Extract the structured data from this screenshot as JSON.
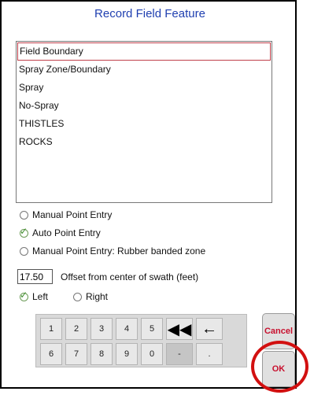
{
  "dialog": {
    "title": "Record Field Feature",
    "features": [
      "Field Boundary",
      "Spray Zone/Boundary",
      "Spray",
      "No-Spray",
      "THISTLES",
      "ROCKS"
    ],
    "selected_feature": "Field Boundary",
    "entry_modes": [
      {
        "label": "Manual Point Entry",
        "checked": false
      },
      {
        "label": "Auto Point Entry",
        "checked": true
      },
      {
        "label": "Manual Point Entry: Rubber banded zone",
        "checked": false
      }
    ],
    "offset": {
      "value": "17.50",
      "label": "Offset from center of swath (feet)"
    },
    "side": {
      "left_label": "Left",
      "right_label": "Right",
      "selected": "Left"
    },
    "keypad": {
      "row1": [
        "1",
        "2",
        "3",
        "4",
        "5",
        "◀◀",
        "←"
      ],
      "row2": [
        "6",
        "7",
        "8",
        "9",
        "0",
        "-",
        "."
      ]
    },
    "cancel_label": "Cancel",
    "ok_label": "OK"
  }
}
